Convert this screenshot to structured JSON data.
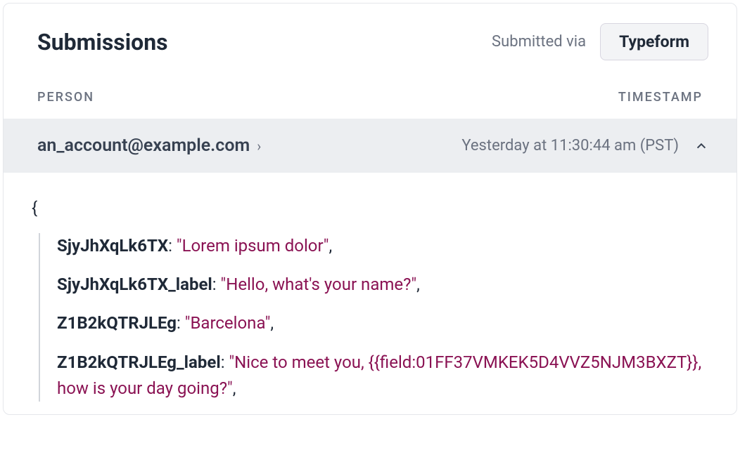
{
  "header": {
    "title": "Submissions",
    "submitted_via_label": "Submitted via",
    "source": "Typeform"
  },
  "columns": {
    "person": "PERSON",
    "timestamp": "TIMESTAMP"
  },
  "row": {
    "person": "an_account@example.com",
    "timestamp": "Yesterday at 11:30:44 am (PST)"
  },
  "payload": {
    "entries": [
      {
        "key": "SjyJhXqLk6TX",
        "value": "\"Lorem ipsum dolor\""
      },
      {
        "key": "SjyJhXqLk6TX_label",
        "value": "\"Hello, what's your name?\""
      },
      {
        "key": "Z1B2kQTRJLEg",
        "value": "\"Barcelona\""
      },
      {
        "key": "Z1B2kQTRJLEg_label",
        "value": "\"Nice to meet you, {{field:01FF37VMKEK5D4VVZ5NJM3BXZT}}, how is your day going?\""
      }
    ]
  }
}
